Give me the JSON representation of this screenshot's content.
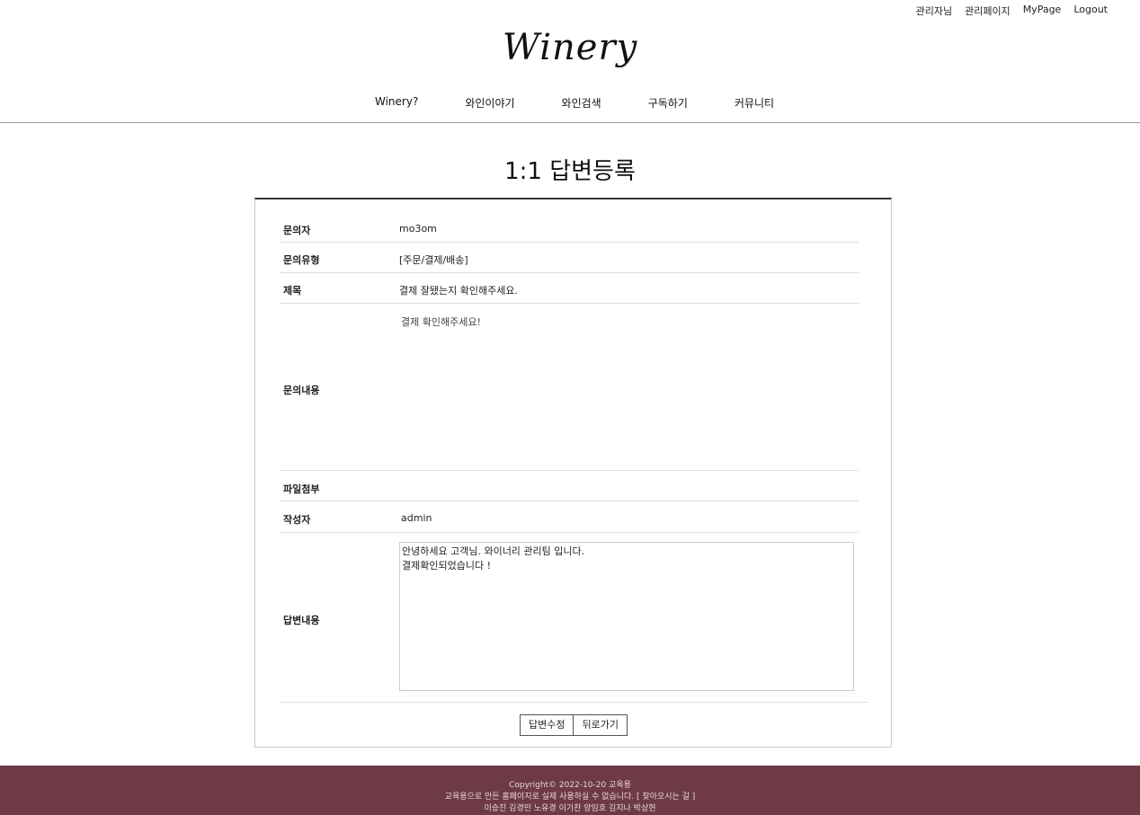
{
  "header": {
    "util_links": [
      "관리자님",
      "관리페이지",
      "MyPage",
      "Logout"
    ],
    "logo": "Winery",
    "nav": [
      "Winery?",
      "와인이야기",
      "와인검색",
      "구독하기",
      "커뮤니티"
    ]
  },
  "page": {
    "title": "1:1 답변등록"
  },
  "form": {
    "inquirer_label": "문의자",
    "inquirer_value": "mo3om",
    "type_label": "문의유형",
    "type_value": "[주문/결제/배송]",
    "subject_label": "제목",
    "subject_value": "결제 잘됐는지 확인해주세요.",
    "content_label": "문의내용",
    "content_value": "결제 확인해주세요!",
    "attachment_label": "파일첨부",
    "writer_label": "작성자",
    "writer_value": "admin",
    "answer_label": "답변내용",
    "answer_lines": [
      "안녕하세요 고객님. 와이너리 관리팀 입니다.",
      "결제확인되었습니다 !"
    ]
  },
  "buttons": {
    "edit_label": "답변수정",
    "back_label": "뒤로가기"
  },
  "footer": {
    "line1": "Copyright© 2022-10-20 교육용",
    "line2": "교육용으로 만든 홈페이지로 실제 사용하실 수 없습니다. [ 찾아오시는 길 ]",
    "line3": "이승진 김경민 노유경 이기찬 양임호 김지나 박상현"
  },
  "colors": {
    "footer_bg": "#6d3a45",
    "panel_top_border": "#333333"
  }
}
